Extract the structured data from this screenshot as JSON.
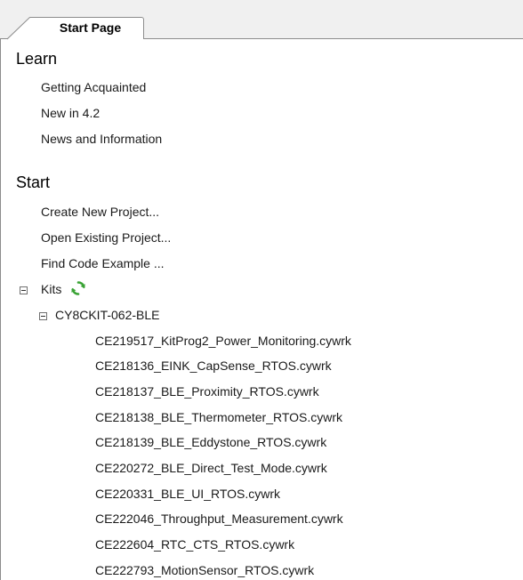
{
  "tab": {
    "label": "Start Page"
  },
  "learn": {
    "heading": "Learn",
    "links": [
      "Getting Acquainted",
      "New in 4.2",
      "News and Information"
    ]
  },
  "start": {
    "heading": "Start",
    "links": [
      "Create New Project...",
      "Open Existing Project...",
      "Find Code Example ..."
    ]
  },
  "kits": {
    "label": "Kits",
    "refresh_icon": "refresh-icon",
    "kit": {
      "label": "CY8CKIT-062-BLE",
      "files": [
        "CE219517_KitProg2_Power_Monitoring.cywrk",
        "CE218136_EINK_CapSense_RTOS.cywrk",
        "CE218137_BLE_Proximity_RTOS.cywrk",
        "CE218138_BLE_Thermometer_RTOS.cywrk",
        "CE218139_BLE_Eddystone_RTOS.cywrk",
        "CE220272_BLE_Direct_Test_Mode.cywrk",
        "CE220331_BLE_UI_RTOS.cywrk",
        "CE222046_Throughput_Measurement.cywrk",
        "CE222604_RTC_CTS_RTOS.cywrk",
        "CE222793_MotionSensor_RTOS.cywrk"
      ]
    }
  },
  "colors": {
    "border": "#8c8c8c",
    "tabstrip": "#f0f0f0",
    "refresh_green": "#3aa335"
  }
}
